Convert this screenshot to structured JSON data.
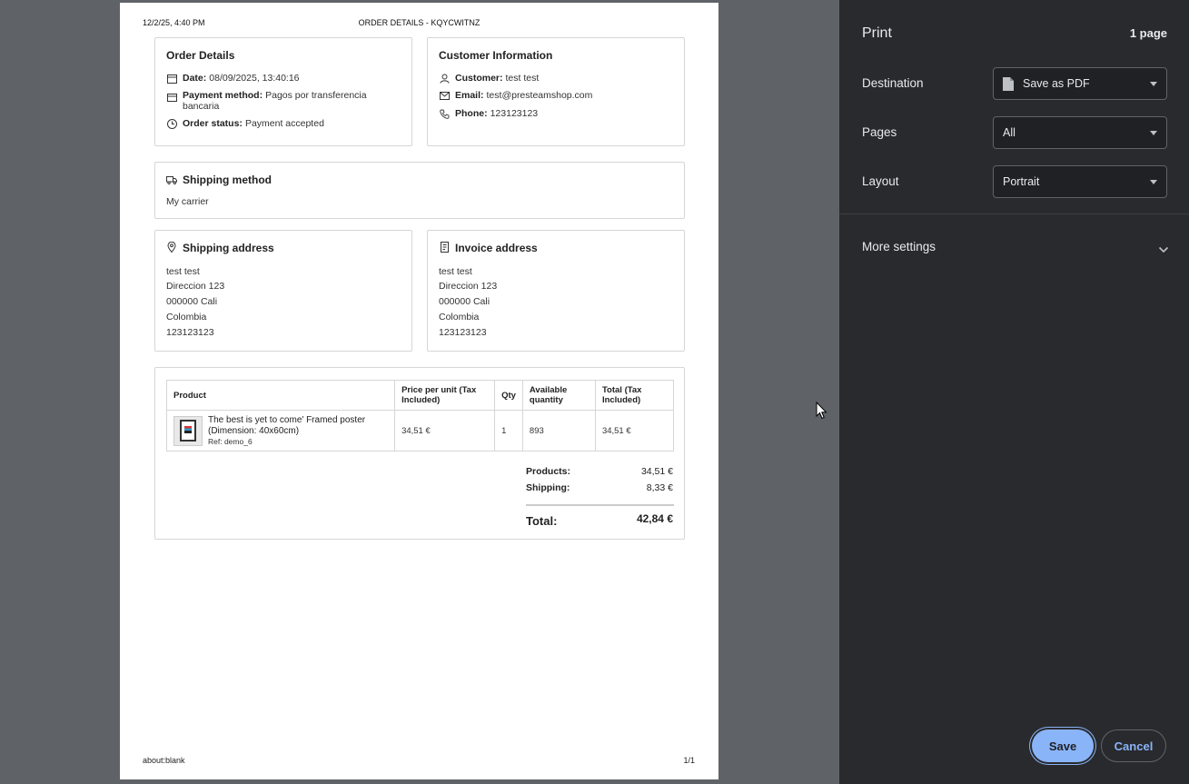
{
  "sheet": {
    "header_date": "12/2/25, 4:40 PM",
    "header_title": "ORDER DETAILS - KQYCWITNZ",
    "footer_url": "about:blank",
    "footer_page": "1/1"
  },
  "order": {
    "title": "Order Details",
    "date_label": "Date:",
    "date_value": "08/09/2025, 13:40:16",
    "payment_label": "Payment method:",
    "payment_value": "Pagos por transferencia bancaria",
    "status_label": "Order status:",
    "status_value": "Payment accepted"
  },
  "customer": {
    "title": "Customer Information",
    "customer_label": "Customer:",
    "customer_value": "test test",
    "email_label": "Email:",
    "email_value": "test@presteamshop.com",
    "phone_label": "Phone:",
    "phone_value": "123123123"
  },
  "shipping_method": {
    "title": "Shipping method",
    "value": "My carrier"
  },
  "shipping_address": {
    "title": "Shipping address",
    "lines": [
      "test test",
      "Direccion 123",
      "000000 Cali",
      "Colombia",
      "123123123"
    ]
  },
  "invoice_address": {
    "title": "Invoice address",
    "lines": [
      "test test",
      "Direccion 123",
      "000000 Cali",
      "Colombia",
      "123123123"
    ]
  },
  "products": {
    "headers": [
      "Product",
      "Price per unit (Tax Included)",
      "Qty",
      "Available quantity",
      "Total (Tax Included)"
    ],
    "rows": [
      {
        "name": "The best is yet to come' Framed poster (Dimension: 40x60cm)",
        "ref": "Ref: demo_6",
        "price": "34,51 €",
        "qty": "1",
        "available": "893",
        "total": "34,51 €"
      }
    ]
  },
  "totals": {
    "products_label": "Products:",
    "products_value": "34,51 €",
    "shipping_label": "Shipping:",
    "shipping_value": "8,33 €",
    "total_label": "Total:",
    "total_value": "42,84 €"
  },
  "print_panel": {
    "title": "Print",
    "page_count": "1 page",
    "destination_label": "Destination",
    "destination_value": "Save as PDF",
    "pages_label": "Pages",
    "pages_value": "All",
    "layout_label": "Layout",
    "layout_value": "Portrait",
    "more_settings": "More settings",
    "save_label": "Save",
    "cancel_label": "Cancel",
    "accent_color": "#8ab4f8",
    "background_color": "#292a2d"
  }
}
